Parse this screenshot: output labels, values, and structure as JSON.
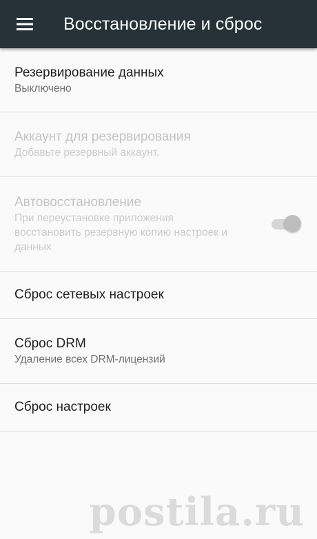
{
  "toolbar": {
    "title": "Восстановление и сброс",
    "menu_icon": "hamburger-menu-icon"
  },
  "items": [
    {
      "title": "Резервирование данных",
      "subtitle": "Выключено",
      "enabled": true
    },
    {
      "title": "Аккаунт для резервирования",
      "subtitle": "Добавьте резервный аккаунт.",
      "enabled": false
    },
    {
      "title": "Автовосстановление",
      "subtitle": "При переустановке приложения восстановить резервную копию настроек и данных",
      "enabled": false,
      "toggle_on": true
    },
    {
      "title": "Сброс сетевых настроек",
      "enabled": true
    },
    {
      "title": "Сброс DRM",
      "subtitle": "Удаление всех DRM-лицензий",
      "enabled": true
    },
    {
      "title": "Сброс настроек",
      "enabled": true
    }
  ],
  "watermark": "postila.ru",
  "colors": {
    "toolbar_bg": "#263238",
    "background": "#fafafa",
    "divider": "#dcdcdc",
    "text_primary": "#212121",
    "text_secondary": "#6f6f6f",
    "text_disabled": "#c4c4c4"
  }
}
